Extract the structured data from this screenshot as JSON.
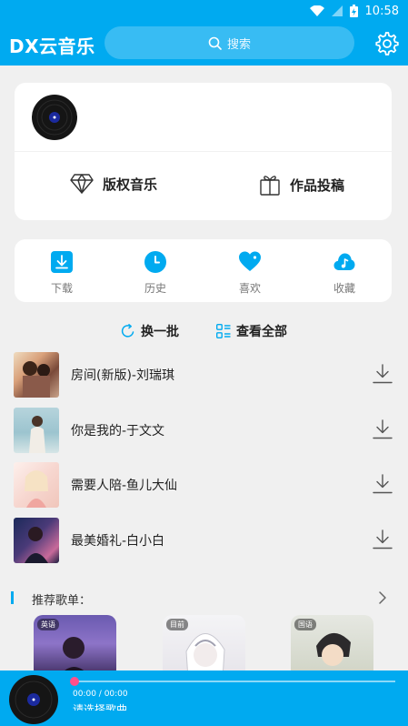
{
  "status_bar": {
    "time": "10:58"
  },
  "app": {
    "title": "DX云音乐",
    "search_placeholder": "搜索"
  },
  "card_actions": {
    "copyright_music": "版权音乐",
    "submit_work": "作品投稿"
  },
  "quick_actions": [
    {
      "label": "下载",
      "icon": "download-icon"
    },
    {
      "label": "历史",
      "icon": "clock-icon"
    },
    {
      "label": "喜欢",
      "icon": "heart-icon"
    },
    {
      "label": "收藏",
      "icon": "cloud-music-icon"
    }
  ],
  "list_controls": {
    "refresh": "换一批",
    "view_all": "查看全部"
  },
  "songs": [
    {
      "title": "房间(新版)-刘瑞琪"
    },
    {
      "title": "你是我的-于文文"
    },
    {
      "title": "需要人陪-鱼儿大仙"
    },
    {
      "title": "最美婚礼-白小白"
    }
  ],
  "recommend": {
    "title": "推荐歌单：",
    "playlists": [
      {
        "tag": "英语"
      },
      {
        "tag": "目前"
      },
      {
        "tag": "国语"
      }
    ]
  },
  "player": {
    "time": "00:00 / 00:00",
    "progress": 0,
    "now_playing": "请选择歌曲"
  },
  "colors": {
    "accent": "#00aaf0",
    "progress_thumb": "#ff4f8b"
  }
}
